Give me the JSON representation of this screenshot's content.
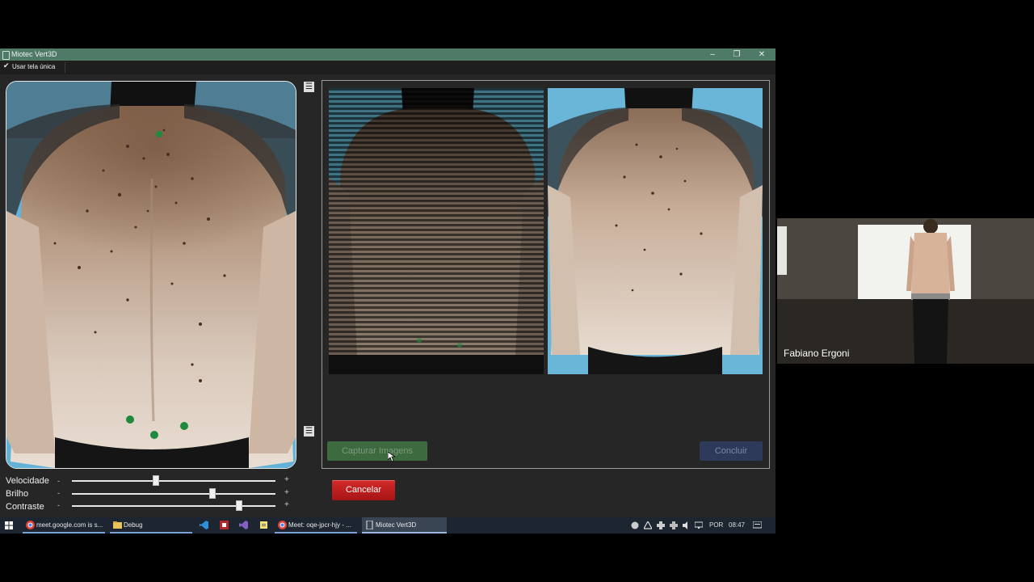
{
  "window": {
    "title": "Miotec Vert3D",
    "minimize_icon": "–",
    "restore_icon": "❐",
    "close_icon": "✕"
  },
  "toolbar": {
    "check_mark": "✔",
    "single_screen_label": "Usar tela única"
  },
  "sliders": [
    {
      "label": "Velocidade",
      "minus": "-",
      "plus": "+",
      "value_fraction": 0.41
    },
    {
      "label": "Brilho",
      "minus": "-",
      "plus": "+",
      "value_fraction": 0.69
    },
    {
      "label": "Contraste",
      "minus": "-",
      "plus": "+",
      "value_fraction": 0.82
    }
  ],
  "buttons": {
    "capture": "Capturar Imagens",
    "conclude": "Concluir",
    "cancel": "Cancelar",
    "panel_toggle_top_icon": "☰",
    "panel_toggle_bottom_icon": "☰"
  },
  "taskbar": {
    "start_icon": "windows-icon",
    "items": [
      {
        "label": "meet.google.com is s...",
        "icon": "chrome-icon"
      },
      {
        "label": "Debug",
        "icon": "folder-icon"
      },
      {
        "label": "",
        "icon": "vscode-icon"
      },
      {
        "label": "",
        "icon": "app-red-icon"
      },
      {
        "label": "",
        "icon": "visual-studio-icon"
      },
      {
        "label": "",
        "icon": "notes-icon"
      },
      {
        "label": "Meet: oqe-jpcr-hjy - ...",
        "icon": "chrome-icon"
      },
      {
        "label": "Miotec Vert3D",
        "icon": "miotec-icon"
      }
    ],
    "tray": {
      "language": "POR",
      "time": "08:47"
    }
  },
  "video": {
    "participant_name": "Fabiano Ergoni"
  },
  "colors": {
    "titlebar": "#4f7a68",
    "capture_button": "#3d6a3f",
    "conclude_button": "#2e3a5a",
    "cancel_button": "#c21e1e",
    "marker_green": "#1f8a3c"
  }
}
